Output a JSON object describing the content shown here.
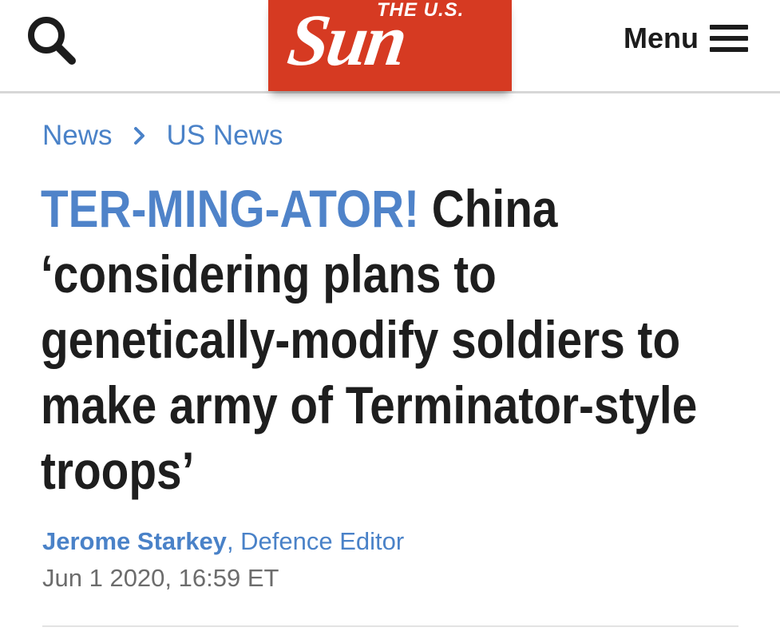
{
  "header": {
    "logo_top_text": "THE U.S.",
    "logo_main_text": "Sun",
    "logo_color": "#d63a22",
    "search_icon": "search-icon",
    "menu_label": "Menu",
    "menu_icon": "hamburger-icon"
  },
  "breadcrumb": {
    "items": [
      "News",
      "US News"
    ],
    "separator_icon": "chevron-right-icon",
    "color": "#4a82c8"
  },
  "article": {
    "kicker": "TER-MING-ATOR!",
    "headline": "China ‘considering plans to genetically-modify soldiers to make army of Terminator-style troops’",
    "kicker_color": "#4f83c9",
    "author": "Jerome Starkey",
    "author_separator": ", ",
    "author_role": "Defence Editor",
    "timestamp": "Jun 1 2020, 16:59 ET"
  }
}
